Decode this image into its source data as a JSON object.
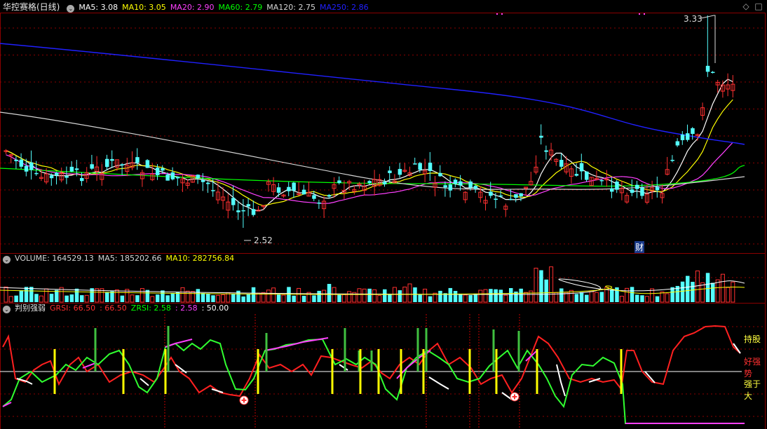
{
  "colors": {
    "up": "#ff3030",
    "down": "#54ffff",
    "ma5": "#ffffff",
    "ma10": "#ffff00",
    "ma20": "#ff40ff",
    "ma60": "#00ff00",
    "ma120": "#d6d6d6",
    "ma250": "#2020ff",
    "grid": "#8b0000",
    "vline": "#c40000"
  },
  "price_panel": {
    "title": "华控赛格(日线)",
    "ma_labels": [
      {
        "text": "MA5: 3.08",
        "color": "#ffffff"
      },
      {
        "text": "MA10: 3.05",
        "color": "#ffff00"
      },
      {
        "text": "MA20: 2.90",
        "color": "#ff40ff"
      },
      {
        "text": "MA60: 2.79",
        "color": "#00ff00"
      },
      {
        "text": "MA120: 2.75",
        "color": "#d6d6d6"
      },
      {
        "text": "MA250: 2.86",
        "color": "#2020ff"
      }
    ],
    "high_label": "3.33",
    "low_label": "2.52",
    "finance_marker": "财"
  },
  "volume_panel": {
    "labels": [
      {
        "text": "VOLUME: 164529.13",
        "color": "#d6d6d6"
      },
      {
        "text": "MA5: 185202.66",
        "color": "#d6d6d6"
      },
      {
        "text": "MA10: 282756.84",
        "color": "#ffff00"
      }
    ]
  },
  "indicator_panel": {
    "title": "判别强弱",
    "labels": [
      {
        "text": "GRSI: 66.50",
        "color": "#ff3030"
      },
      {
        "text": ": 66.50",
        "color": "#ff3030"
      },
      {
        "text": "ZRSI: 2.58",
        "color": "#00ff00"
      },
      {
        "text": ": 2.58",
        "color": "#ff40ff"
      },
      {
        "text": ": 50.00",
        "color": "#ffffff"
      }
    ],
    "zone_labels": [
      {
        "text": "持股",
        "color": "#ffff40"
      },
      {
        "text": "好强势",
        "color": "#ff3030"
      },
      {
        "text": "强于大",
        "color": "#ffff40"
      }
    ]
  },
  "icons": {
    "diamond": "◇",
    "square": "□",
    "collapse": "⌄",
    "plus": "+"
  }
}
